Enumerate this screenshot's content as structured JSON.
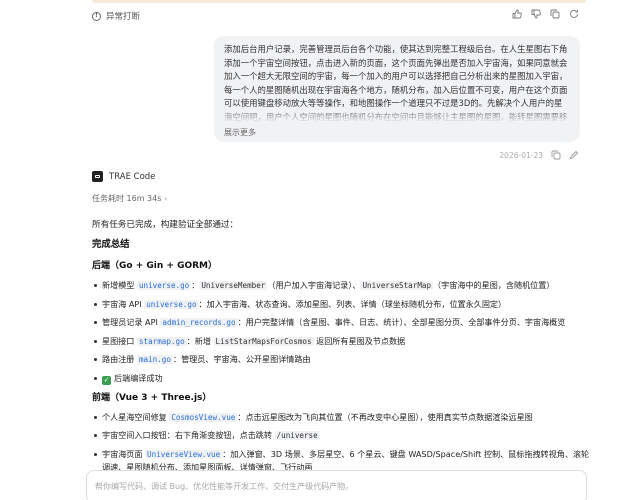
{
  "top": {
    "abort_label": "异常打断"
  },
  "user_message": {
    "text": "添加后台用户记录，完善管理员后台各个功能，使其达到完整工程级后台。在人生星图右下角添加一个宇宙空间按钮，点击进入新的页面，这个页面先弹出是否加入宇宙海，如果同意就会加入一个超大无限空间的宇宙，每一个加入的用户可以选择把自己分析出来的星图加入宇宙，每一个人的星图随机出现在宇宙海各个地方，随机分布，加入后位置不可变，用户在这个页面可以使用键盘移动放大等等操作，和地图操作一个道理只不过是3D的。先解决个人用户的星海空间吧，用户个人空间的星图也随机分布在空间中且能够让主星图的星图，能转星图需要移动到那个星图的位置，不能在页面",
    "show_more": "展示更多",
    "time": "2026-01-23"
  },
  "agent": {
    "name": "TRAE Code",
    "task_time": "任务耗时 16m 34s"
  },
  "summary": {
    "intro": "所有任务已完成，构建验证全部通过：",
    "title": "完成总结",
    "backend_title": "后端（Go + Gin + GORM）",
    "backend_items": [
      {
        "prefix": "新增模型 ",
        "code1": "universe.go",
        "mid1": "：",
        "code2": "UniverseMember",
        "mid2": "（用户加入宇宙海记录）、",
        "code3": "UniverseStarMap",
        "suffix": "（宇宙海中的星图，含随机位置）"
      },
      {
        "prefix": "宇宙海 API ",
        "code1": "universe.go",
        "suffix": "：加入宇宙海、状态查询、添加星图、列表、详情（球坐标随机分布，位置永久固定）"
      },
      {
        "prefix": "管理员记录 API ",
        "code1": "admin_records.go",
        "suffix": "：用户完整详情（含星图、事件、日志、统计）、全部星图分页、全部事件分页、宇宙海概览"
      },
      {
        "prefix": "星图接口 ",
        "code1": "starmap.go",
        "mid1": "：新增 ",
        "code2": "ListStarMapsForCosmos",
        "suffix": " 返回所有星图及节点数据"
      },
      {
        "prefix": "路由注册 ",
        "code1": "main.go",
        "suffix": "：管理员、宇宙海、公开星图详情路由"
      },
      {
        "check": true,
        "suffix": "后端编译成功"
      }
    ],
    "frontend_title": "前端（Vue 3 + Three.js）",
    "frontend_items": [
      {
        "prefix": "个人星海空间修复 ",
        "code1": "CosmosView.vue",
        "suffix": "：点击远星图改为飞向其位置（不再改变中心星图），使用真实节点数据渲染远星图"
      },
      {
        "prefix": "宇宙空间入口按钮：右下角渐变按钮，点击跳转 ",
        "code1": "/universe",
        "suffix": ""
      },
      {
        "prefix": "宇宙海页面 ",
        "code1": "UniverseView.vue",
        "suffix": "：加入弹窗、3D 场景、多层星空、6 个星云、键盘 WASD/Space/Shift 控制、鼠标拖拽转视角、滚轮调速、星图随机分布、添加星图面板、详情弹窗、飞行动画"
      }
    ]
  },
  "input": {
    "placeholder": "帮你编写代码、调试 Bug、优化性能等开发工作、交付生产级代码产物。"
  }
}
